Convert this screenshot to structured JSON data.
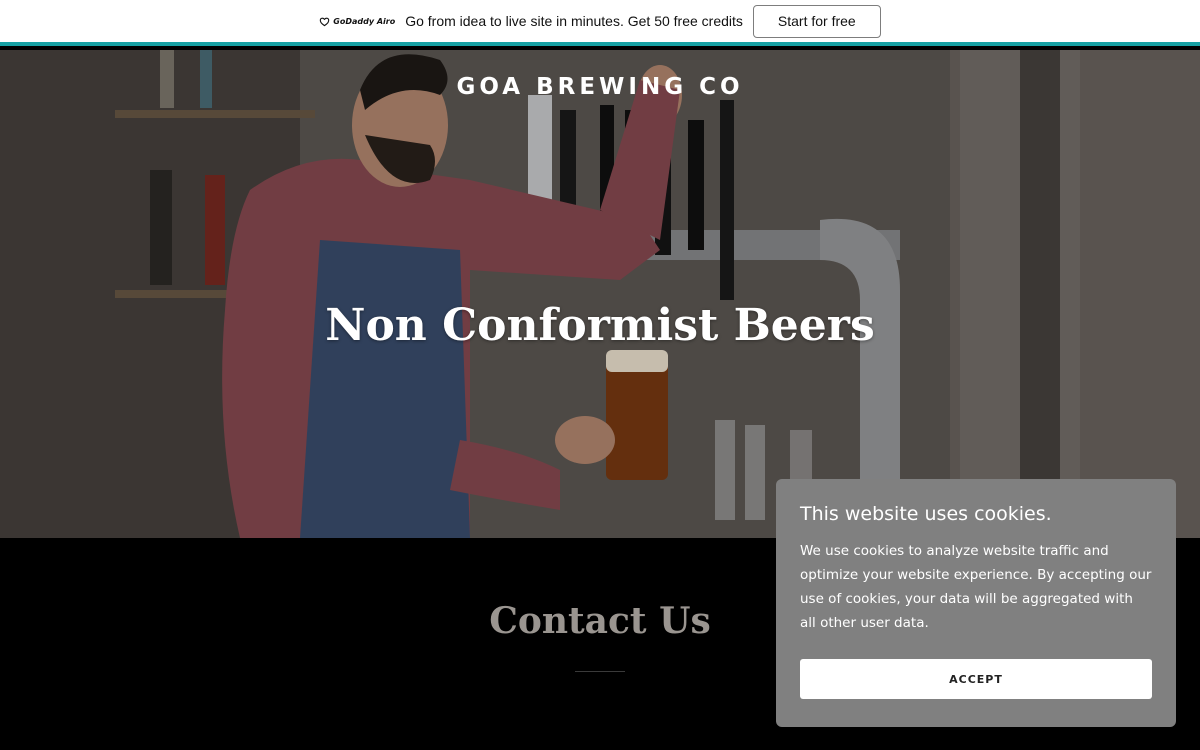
{
  "promo": {
    "logo_text": "GoDaddy Airo",
    "message": "Go from idea to live site in minutes. Get 50 free credits",
    "cta_label": "Start for free",
    "accent_color": "#16a0a3"
  },
  "hero": {
    "brand": "GOA BREWING CO",
    "title": "Non Conformist Beers"
  },
  "contact": {
    "title": "Contact Us"
  },
  "cookie_banner": {
    "title": "This website uses cookies.",
    "body": "We use cookies to analyze website traffic and optimize your website experience. By accepting our use of cookies, your data will be aggregated with all other user data.",
    "accept_label": "ACCEPT",
    "background_color": "#808080"
  }
}
